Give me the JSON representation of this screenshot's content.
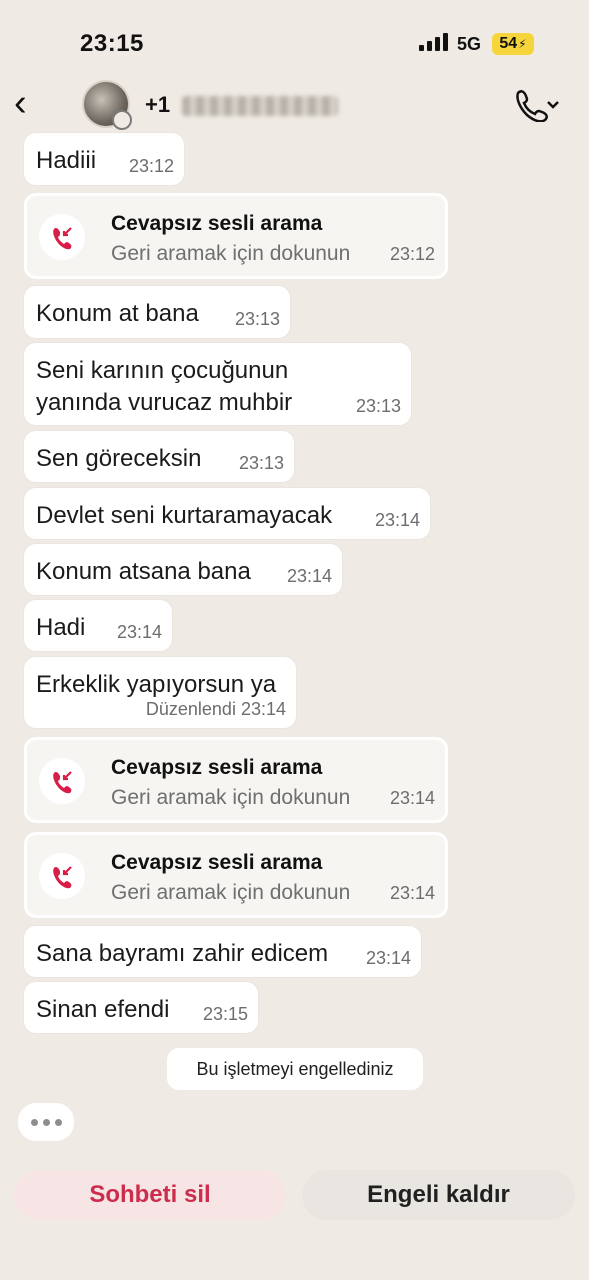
{
  "status": {
    "time": "23:15",
    "network": "5G",
    "battery": "54"
  },
  "header": {
    "contact": "+1",
    "back_icon": "chevron-left-icon",
    "call_icon": "phone-icon"
  },
  "messages": [
    {
      "text": "Hadiii",
      "time": "23:12"
    },
    {
      "type": "missed_call",
      "title": "Cevapsız sesli arama",
      "subtitle": "Geri aramak için dokunun",
      "time": "23:12"
    },
    {
      "text": "Konum at bana",
      "time": "23:13"
    },
    {
      "text": "Seni karının çocuğunun yanında vurucaz muhbir",
      "time": "23:13"
    },
    {
      "text": "Sen göreceksin",
      "time": "23:13"
    },
    {
      "text": "Devlet seni kurtaramayacak",
      "time": "23:14"
    },
    {
      "text": "Konum atsana bana",
      "time": "23:14"
    },
    {
      "text": "Hadi",
      "time": "23:14"
    },
    {
      "text": "Erkeklik yapıyorsun ya",
      "edited": "Düzenlendi",
      "time": "23:14"
    },
    {
      "type": "missed_call",
      "title": "Cevapsız sesli arama",
      "subtitle": "Geri aramak için dokunun",
      "time": "23:14"
    },
    {
      "type": "missed_call",
      "title": "Cevapsız sesli arama",
      "subtitle": "Geri aramak için dokunun",
      "time": "23:14"
    },
    {
      "text": "Sana bayramı zahir edicem",
      "time": "23:14"
    },
    {
      "text": "Sinan efendi",
      "time": "23:15"
    }
  ],
  "system_note": "Bu işletmeyi engellediniz",
  "actions": {
    "delete": "Sohbeti sil",
    "unblock": "Engeli kaldır"
  },
  "colors": {
    "background": "#efebe4",
    "missed_call": "#d81e48",
    "delete_text": "#cc2d4d"
  }
}
